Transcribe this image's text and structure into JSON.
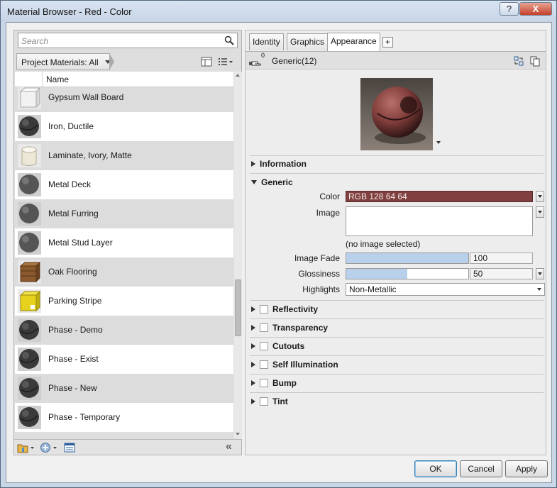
{
  "window": {
    "title": "Material Browser - Red - Color",
    "help_label": "?",
    "close_label": "X"
  },
  "library": {
    "search_placeholder": "Search",
    "filter_label": "Project Materials: All",
    "name_header": "Name",
    "collapse_label": "«",
    "materials": [
      {
        "name": "Gypsum Wall Board",
        "thumb": "box-white"
      },
      {
        "name": "Iron, Ductile",
        "thumb": "sphere-dark"
      },
      {
        "name": "Laminate, Ivory, Matte",
        "thumb": "cylinder-ivory"
      },
      {
        "name": "Metal Deck",
        "thumb": "sphere-gray"
      },
      {
        "name": "Metal Furring",
        "thumb": "sphere-gray"
      },
      {
        "name": "Metal Stud Layer",
        "thumb": "sphere-gray"
      },
      {
        "name": "Oak Flooring",
        "thumb": "box-wood"
      },
      {
        "name": "Parking Stripe",
        "thumb": "box-yellow"
      },
      {
        "name": "Phase - Demo",
        "thumb": "sphere-dark"
      },
      {
        "name": "Phase - Exist",
        "thumb": "sphere-dark"
      },
      {
        "name": "Phase - New",
        "thumb": "sphere-dark"
      },
      {
        "name": "Phase - Temporary",
        "thumb": "sphere-dark"
      }
    ]
  },
  "editor": {
    "tabs": [
      "Identity",
      "Graphics",
      "Appearance"
    ],
    "active_tab": "Appearance",
    "add_tab_label": "+",
    "asset_count": "0",
    "asset_name": "Generic(12)",
    "sections": {
      "information": "Information",
      "generic": "Generic",
      "reflectivity": "Reflectivity",
      "transparency": "Transparency",
      "cutouts": "Cutouts",
      "self_illumination": "Self Illumination",
      "bump": "Bump",
      "tint": "Tint"
    },
    "props": {
      "color_label": "Color",
      "color_value": "RGB 128 64 64",
      "color_hex": "#804040",
      "image_label": "Image",
      "image_status": "(no image selected)",
      "image_fade_label": "Image Fade",
      "image_fade_value": "100",
      "image_fade_fraction": 1.0,
      "glossiness_label": "Glossiness",
      "glossiness_value": "50",
      "glossiness_fraction": 0.5,
      "highlights_label": "Highlights",
      "highlights_value": "Non-Metallic"
    }
  },
  "buttons": {
    "ok": "OK",
    "cancel": "Cancel",
    "apply": "Apply"
  }
}
